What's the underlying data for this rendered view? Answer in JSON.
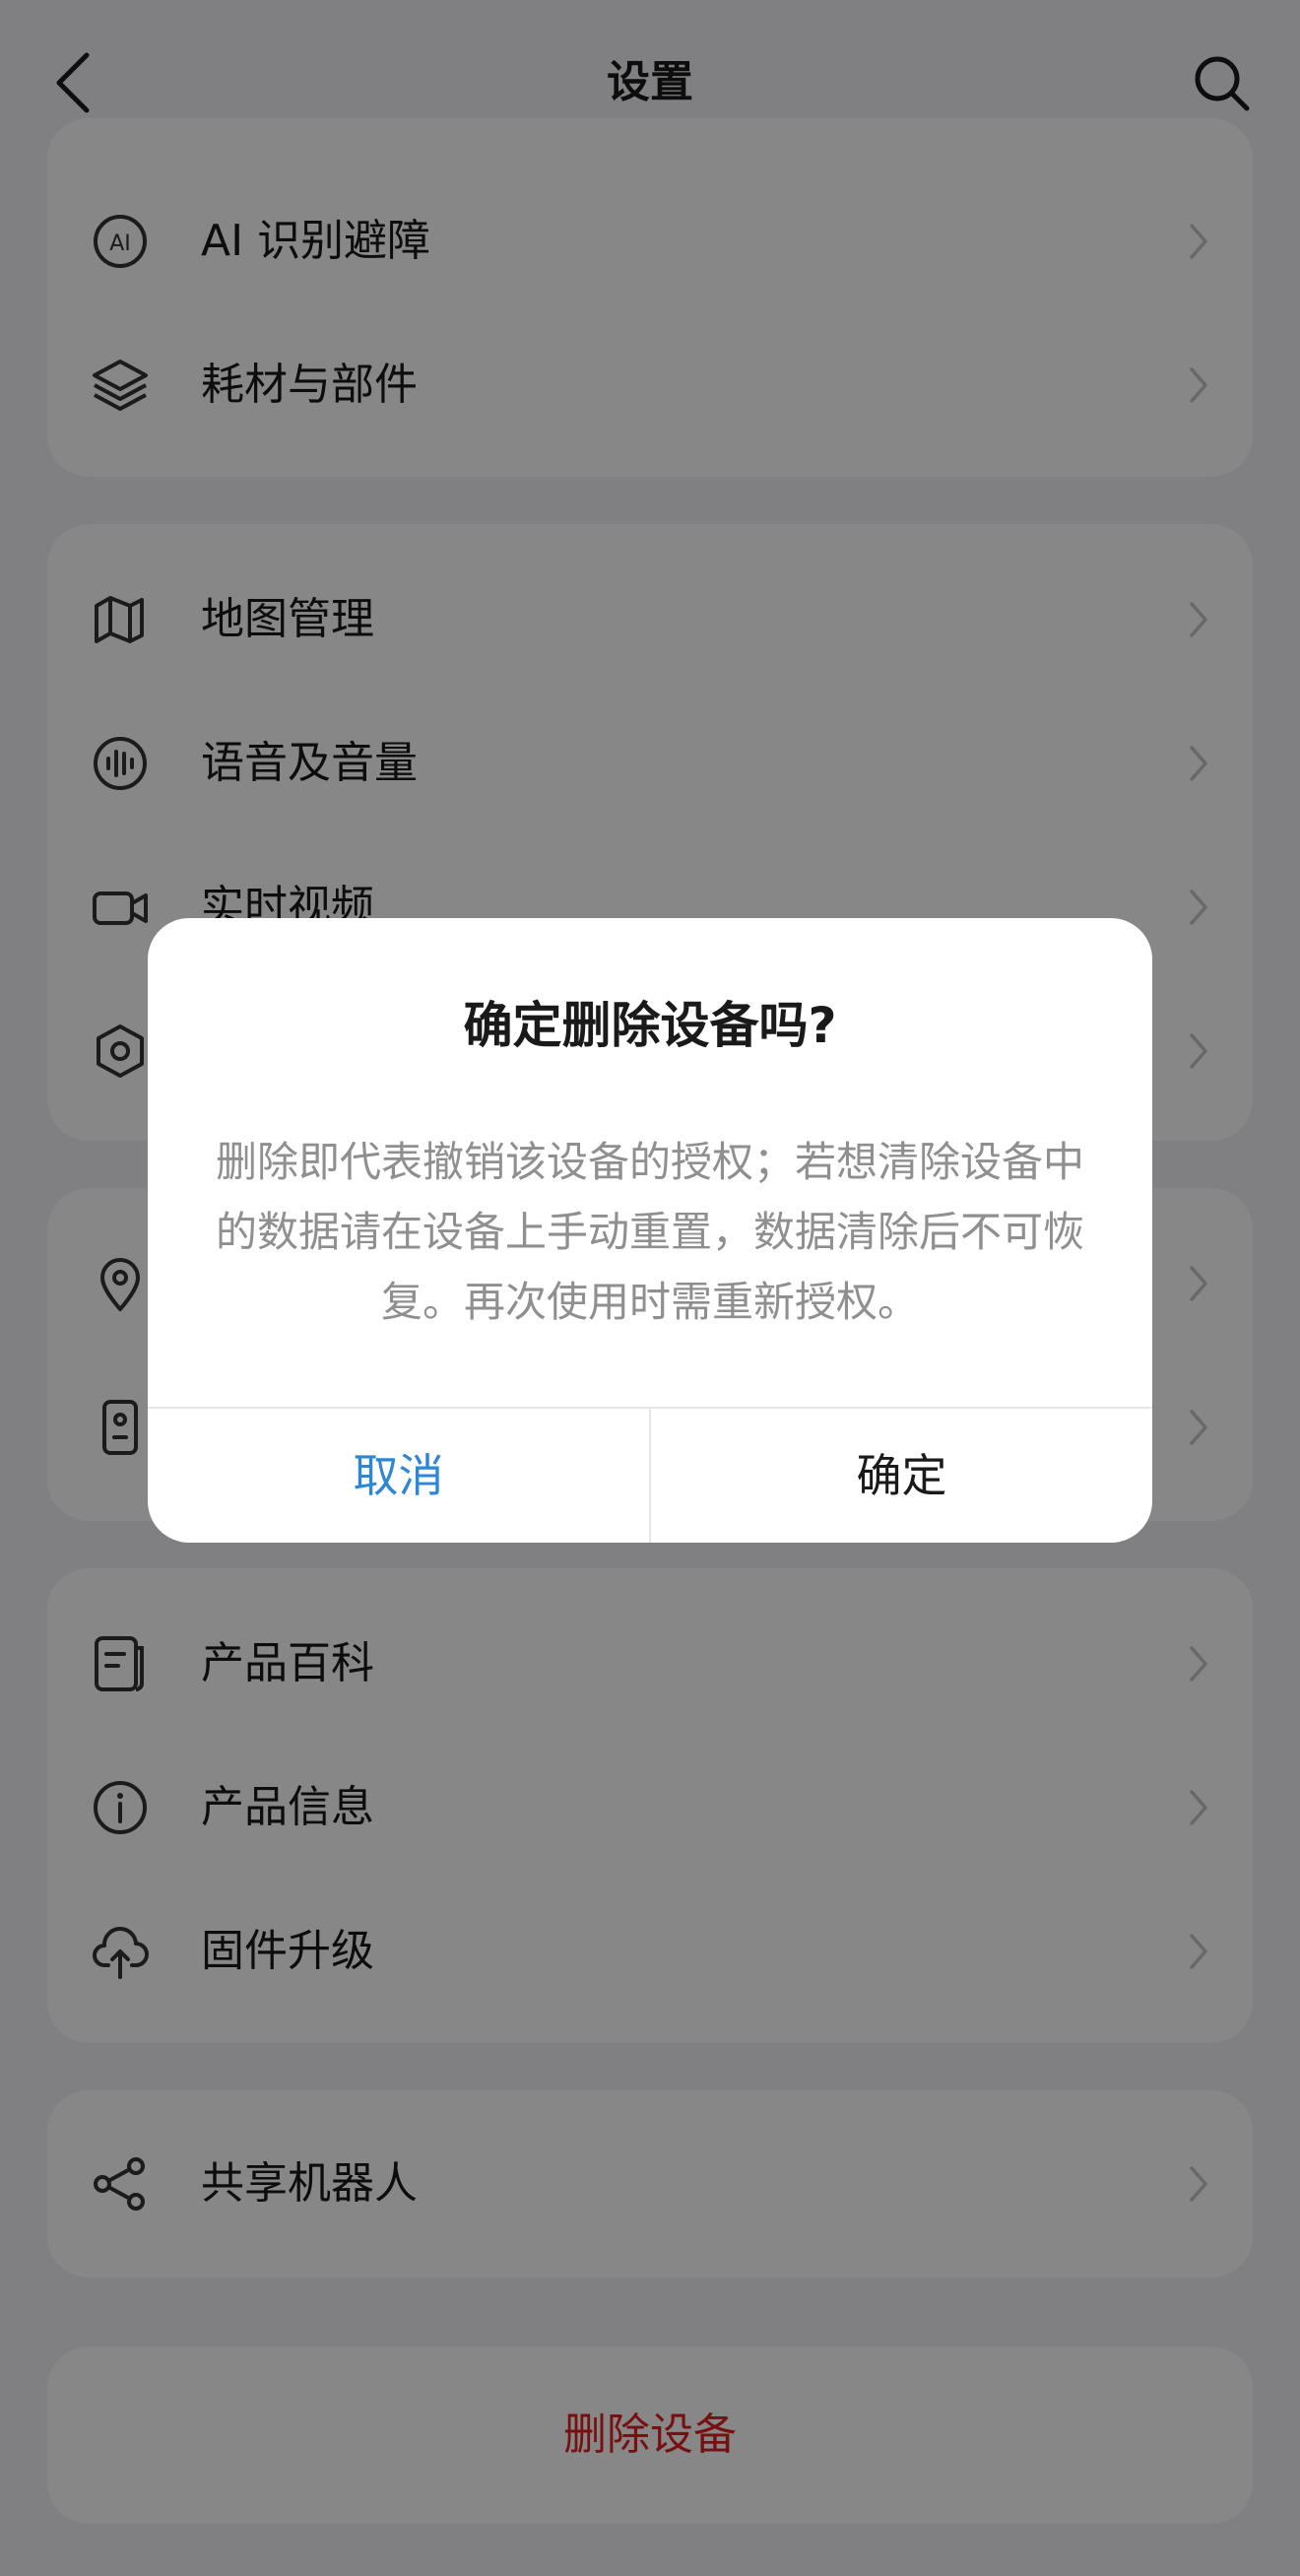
{
  "header": {
    "title": "设置",
    "back_icon": "chevron-left-icon",
    "search_icon": "search-icon"
  },
  "groups": [
    {
      "items": [
        {
          "label": "AI 识别避障",
          "icon": "ai-icon"
        },
        {
          "label": "耗材与部件",
          "icon": "layers-icon"
        }
      ]
    },
    {
      "items": [
        {
          "label": "地图管理",
          "icon": "map-icon"
        },
        {
          "label": "语音及音量",
          "icon": "voice-icon"
        },
        {
          "label": "实时视频",
          "icon": "video-icon"
        },
        {
          "label": "",
          "icon": "hexagon-settings-icon"
        }
      ]
    },
    {
      "items": [
        {
          "label": "",
          "icon": "location-pin-icon"
        },
        {
          "label": "",
          "icon": "device-remote-icon"
        }
      ]
    },
    {
      "items": [
        {
          "label": "产品百科",
          "icon": "book-icon"
        },
        {
          "label": "产品信息",
          "icon": "info-icon"
        },
        {
          "label": "固件升级",
          "icon": "cloud-upload-icon"
        }
      ]
    },
    {
      "items": [
        {
          "label": "共享机器人",
          "icon": "share-icon"
        }
      ]
    }
  ],
  "delete_button": {
    "label": "删除设备",
    "color": "#e02020"
  },
  "dialog": {
    "title": "确定删除设备吗?",
    "message": "删除即代表撤销该设备的授权；若想清除设备中的数据请在设备上手动重置，数据清除后不可恢复。再次使用时需重新授权。",
    "cancel_label": "取消",
    "confirm_label": "确定",
    "cancel_color": "#2f86d6"
  }
}
